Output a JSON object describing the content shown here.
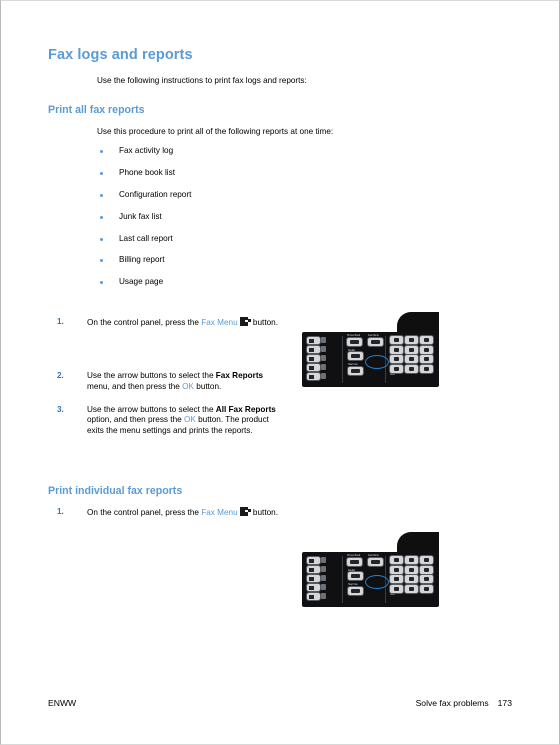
{
  "page": {
    "number": "173",
    "locale_code": "ENWW",
    "running_head": "Solve fax problems"
  },
  "section": {
    "title": "Fax logs and reports",
    "intro": "Use the following instructions to print fax logs and reports:"
  },
  "print_all": {
    "heading": "Print all fax reports",
    "intro": "Use this procedure to print all of the following reports at one time:",
    "reports": [
      "Fax activity log",
      "Phone book list",
      "Configuration report",
      "Junk fax list",
      "Last call report",
      "Billing report",
      "Usage page"
    ],
    "steps": [
      {
        "num": "1.",
        "pre": "On the control panel, press the ",
        "xref": "Fax Menu",
        "icon": "fax-menu-key-icon",
        "post": " button."
      },
      {
        "num": "2.",
        "pre": "Use the arrow buttons to select the ",
        "bold": "Fax Reports",
        "mid": " menu, and then press the ",
        "xref": "OK",
        "post": " button."
      },
      {
        "num": "3.",
        "pre": "Use the arrow buttons to select the ",
        "bold": "All Fax Reports",
        "mid": " option, and then press the ",
        "xref": "OK",
        "post": " button. The product exits the menu settings and prints the reports."
      }
    ]
  },
  "print_individual": {
    "heading": "Print individual fax reports",
    "steps": [
      {
        "num": "1.",
        "pre": "On the control panel, press the ",
        "xref": "Fax Menu",
        "icon": "fax-menu-key-icon",
        "post": " button."
      }
    ]
  },
  "control_panel_figure": {
    "alt": "Product control panel showing the Fax Menu button circled",
    "labels": {
      "phone_book": "Phone Book",
      "fax_menu": "Fax Menu",
      "redial": "Redial",
      "start_fax": "Start Fax",
      "keypad_note": "ABC"
    },
    "keypad_keys": [
      "1",
      "2",
      "3",
      "4",
      "5",
      "6",
      "7",
      "8",
      "9",
      "*",
      "0",
      "#"
    ],
    "callout_color": "#1f7fd0"
  },
  "colors": {
    "heading_blue": "#5b9bd5",
    "step_number_blue": "#2e75b6",
    "xref_blue": "#5b9bd5",
    "bullet_blue": "#5b9bd5",
    "panel_dark": "#101012"
  }
}
